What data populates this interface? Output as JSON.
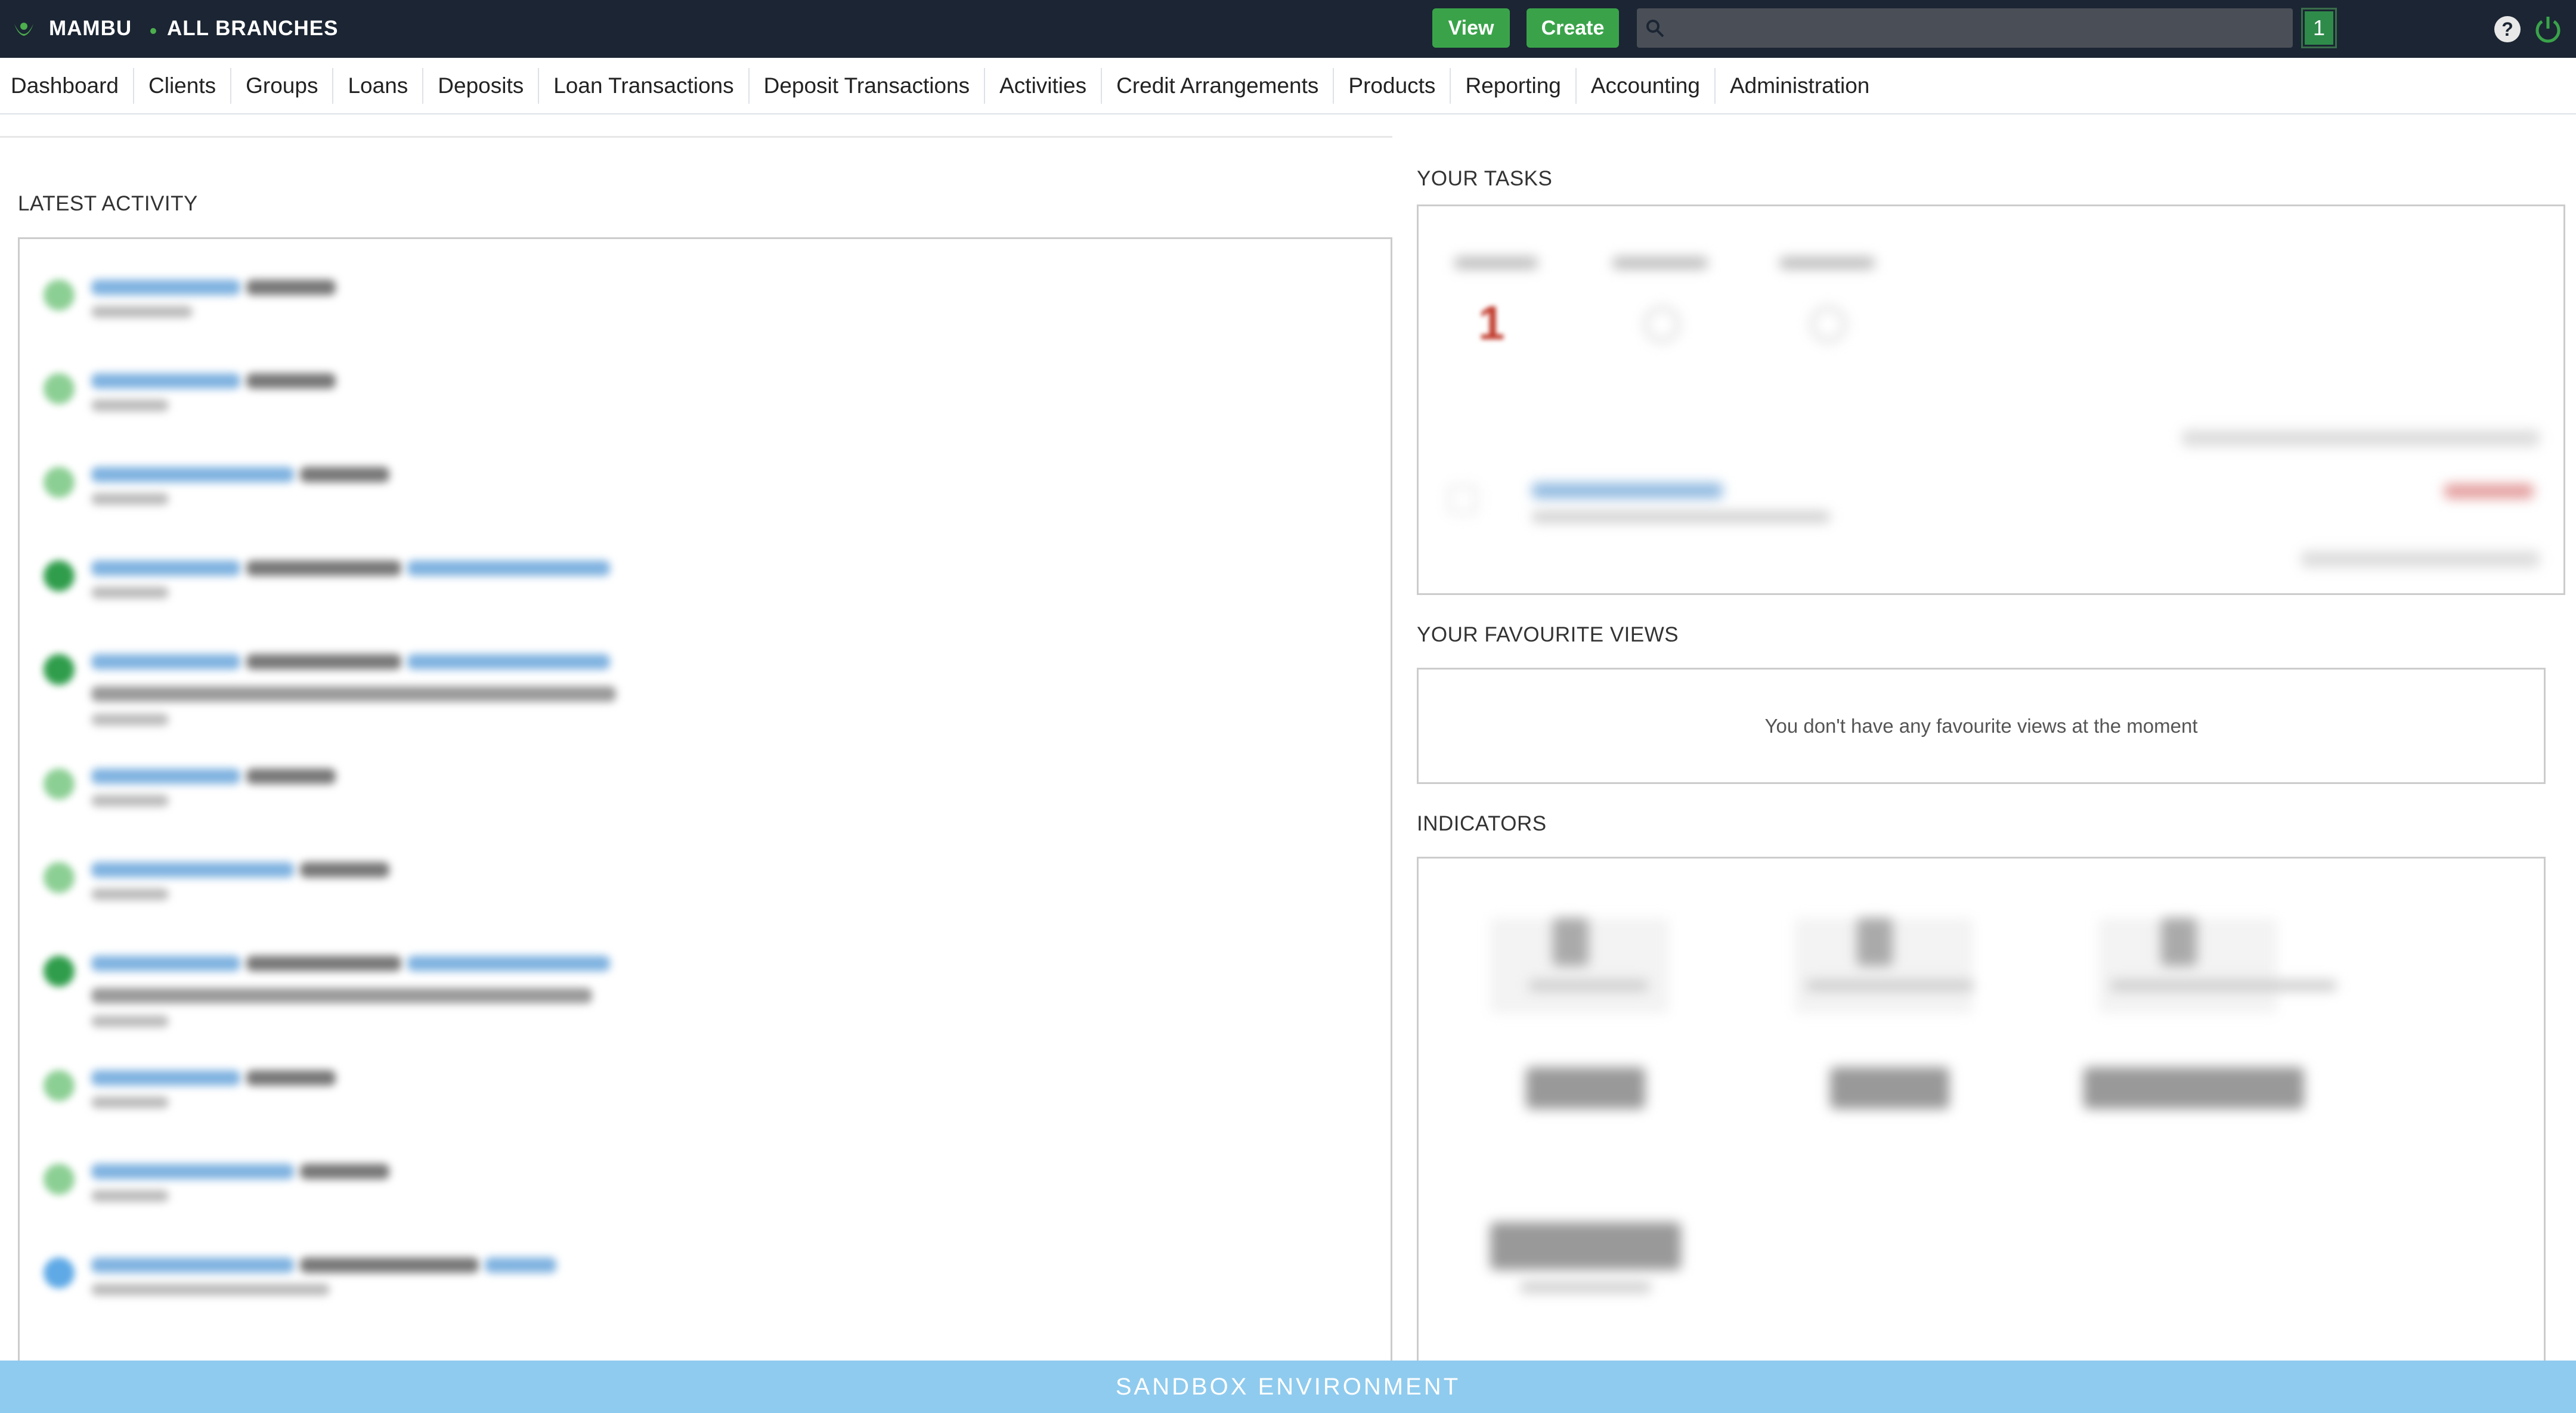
{
  "topbar": {
    "brand": "MAMBU",
    "branch": "ALL BRANCHES",
    "view_label": "View",
    "create_label": "Create",
    "search_placeholder": "",
    "notification_count": "1",
    "bg_color": "#1b2533",
    "accent_color": "#3aa34a"
  },
  "nav": {
    "items": [
      "Dashboard",
      "Clients",
      "Groups",
      "Loans",
      "Deposits",
      "Loan Transactions",
      "Deposit Transactions",
      "Activities",
      "Credit Arrangements",
      "Products",
      "Reporting",
      "Accounting",
      "Administration"
    ]
  },
  "activity": {
    "title": "LATEST ACTIVITY"
  },
  "tasks": {
    "title": "YOUR TASKS",
    "count_overdue": "1"
  },
  "favourites": {
    "title": "YOUR FAVOURITE VIEWS",
    "empty_message": "You don't have any favourite views at the moment"
  },
  "indicators": {
    "title": "INDICATORS"
  },
  "footer": {
    "banner": "SANDBOX ENVIRONMENT",
    "banner_color": "#8fcbee"
  }
}
